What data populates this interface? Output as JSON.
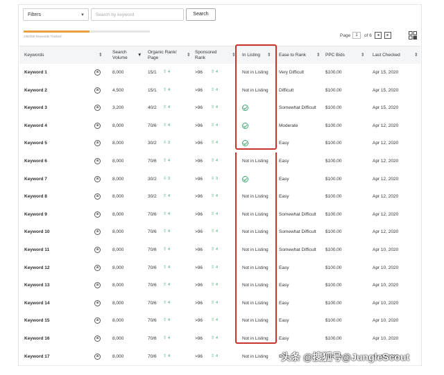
{
  "toolbar": {
    "filters_label": "Filters",
    "search_placeholder": "Search by keyword",
    "search_button": "Search"
  },
  "progress": {
    "text": "236/250 Keywords Tracked",
    "fraction": 0.52
  },
  "pagination": {
    "page_label": "Page",
    "page_value": "1",
    "of_label": "of 6",
    "prev": "◂",
    "next": "▸"
  },
  "columns": {
    "keywords": "Keywords",
    "search_volume_1": "Search",
    "search_volume_2": "Volume",
    "organic_1": "Organic Rank/",
    "organic_2": "Page",
    "sponsored_1": "Sponsored",
    "sponsored_2": "Rank",
    "in_listing": "In Listing",
    "ease": "Ease to Rank",
    "ppc": "PPC Bids",
    "last_checked": "Apr 15, 2020"
  },
  "header_last_checked": "Last Checked",
  "rows": [
    {
      "keyword": "Keyword 1",
      "volume": "8,000",
      "organic": "15/1",
      "org_change": "4",
      "sponsored": ">96",
      "sp_change": "4",
      "listing": "Not in Listing",
      "ease": "Very Difficult",
      "ppc": "$100.00",
      "date": "Apr 15, 2020"
    },
    {
      "keyword": "Keyword 2",
      "volume": "4,500",
      "organic": "15/1",
      "org_change": "4",
      "sponsored": ">96",
      "sp_change": "4",
      "listing": "Not in Listing",
      "ease": "Difficult",
      "ppc": "$100.00",
      "date": "Apr 15, 2020"
    },
    {
      "keyword": "Keyword 3",
      "volume": "3,200",
      "organic": "40/2",
      "org_change": "4",
      "sponsored": ">96",
      "sp_change": "4",
      "listing": "check",
      "ease": "Somewhat Difficult",
      "ppc": "$100.00",
      "date": "Apr 15, 2020"
    },
    {
      "keyword": "Keyword 4",
      "volume": "8,000",
      "organic": "70/6",
      "org_change": "4",
      "sponsored": ">96",
      "sp_change": "4",
      "listing": "check",
      "ease": "Moderate",
      "ppc": "$100.00",
      "date": "Apr 12, 2020"
    },
    {
      "keyword": "Keyword 5",
      "volume": "8,000",
      "organic": "30/2",
      "org_change": "3",
      "sponsored": ">96",
      "sp_change": "4",
      "listing": "check",
      "ease": "Easy",
      "ppc": "$100.00",
      "date": "Apr 12, 2020"
    },
    {
      "keyword": "Keyword 6",
      "volume": "8,000",
      "organic": "70/6",
      "org_change": "4",
      "sponsored": ">96",
      "sp_change": "4",
      "listing": "Not in Listing",
      "ease": "Easy",
      "ppc": "$100.00",
      "date": "Apr 12, 2020"
    },
    {
      "keyword": "Keyword 7",
      "volume": "8,000",
      "organic": "30/2",
      "org_change": "3",
      "sponsored": ">96",
      "sp_change": "3",
      "listing": "check",
      "ease": "Easy",
      "ppc": "$100.00",
      "date": "Apr 12, 2020"
    },
    {
      "keyword": "Keyword 8",
      "volume": "8,000",
      "organic": "30/2",
      "org_change": "4",
      "sponsored": ">96",
      "sp_change": "4",
      "listing": "Not in Listing",
      "ease": "Easy",
      "ppc": "$100.00",
      "date": "Apr 12, 2020"
    },
    {
      "keyword": "Keyword 9",
      "volume": "8,000",
      "organic": "70/6",
      "org_change": "4",
      "sponsored": ">96",
      "sp_change": "4",
      "listing": "Not in Listing",
      "ease": "Somewhat Difficult",
      "ppc": "$100.00",
      "date": "Apr 12, 2020"
    },
    {
      "keyword": "Keyword 10",
      "volume": "8,000",
      "organic": "70/6",
      "org_change": "4",
      "sponsored": ">96",
      "sp_change": "4",
      "listing": "Not in Listing",
      "ease": "Somewhat Difficult",
      "ppc": "$100.00",
      "date": "Apr 12, 2020"
    },
    {
      "keyword": "Keyword 11",
      "volume": "8,000",
      "organic": "70/6",
      "org_change": "4",
      "sponsored": ">96",
      "sp_change": "4",
      "listing": "Not in Listing",
      "ease": "Somewhat Difficult",
      "ppc": "$100.00",
      "date": "Apr 10, 2020"
    },
    {
      "keyword": "Keyword 12",
      "volume": "8,000",
      "organic": "70/6",
      "org_change": "4",
      "sponsored": ">96",
      "sp_change": "4",
      "listing": "Not in Listing",
      "ease": "Easy",
      "ppc": "$100.00",
      "date": "Apr 10, 2020"
    },
    {
      "keyword": "Keyword 13",
      "volume": "8,000",
      "organic": "70/6",
      "org_change": "4",
      "sponsored": ">96",
      "sp_change": "4",
      "listing": "Not in Listing",
      "ease": "Easy",
      "ppc": "$100.00",
      "date": "Apr 10, 2020"
    },
    {
      "keyword": "Keyword 14",
      "volume": "8,000",
      "organic": "70/6",
      "org_change": "4",
      "sponsored": ">96",
      "sp_change": "4",
      "listing": "Not in Listing",
      "ease": "Easy",
      "ppc": "$100.00",
      "date": "Apr 10, 2020"
    },
    {
      "keyword": "Keyword 15",
      "volume": "8,000",
      "organic": "70/6",
      "org_change": "4",
      "sponsored": ">96",
      "sp_change": "4",
      "listing": "Not in Listing",
      "ease": "Easy",
      "ppc": "$100.00",
      "date": "Apr 10, 2020"
    },
    {
      "keyword": "Keyword 16",
      "volume": "8,000",
      "organic": "70/6",
      "org_change": "4",
      "sponsored": ">96",
      "sp_change": "4",
      "listing": "Not in Listing",
      "ease": "Easy",
      "ppc": "$100.00",
      "date": "Apr 10, 2020"
    },
    {
      "keyword": "Keyword 17",
      "volume": "8,000",
      "organic": "70/6",
      "org_change": "4",
      "sponsored": ">96",
      "sp_change": "4",
      "listing": "Not in Listing",
      "ease": "Easy",
      "ppc": "$100.00",
      "date": "Apr 10, 2020"
    }
  ],
  "watermark": "头条 @搜狐号@JungleScout",
  "colors": {
    "accent": "#e7a13c",
    "highlight": "#c8352b",
    "positive": "#3aa66b"
  }
}
